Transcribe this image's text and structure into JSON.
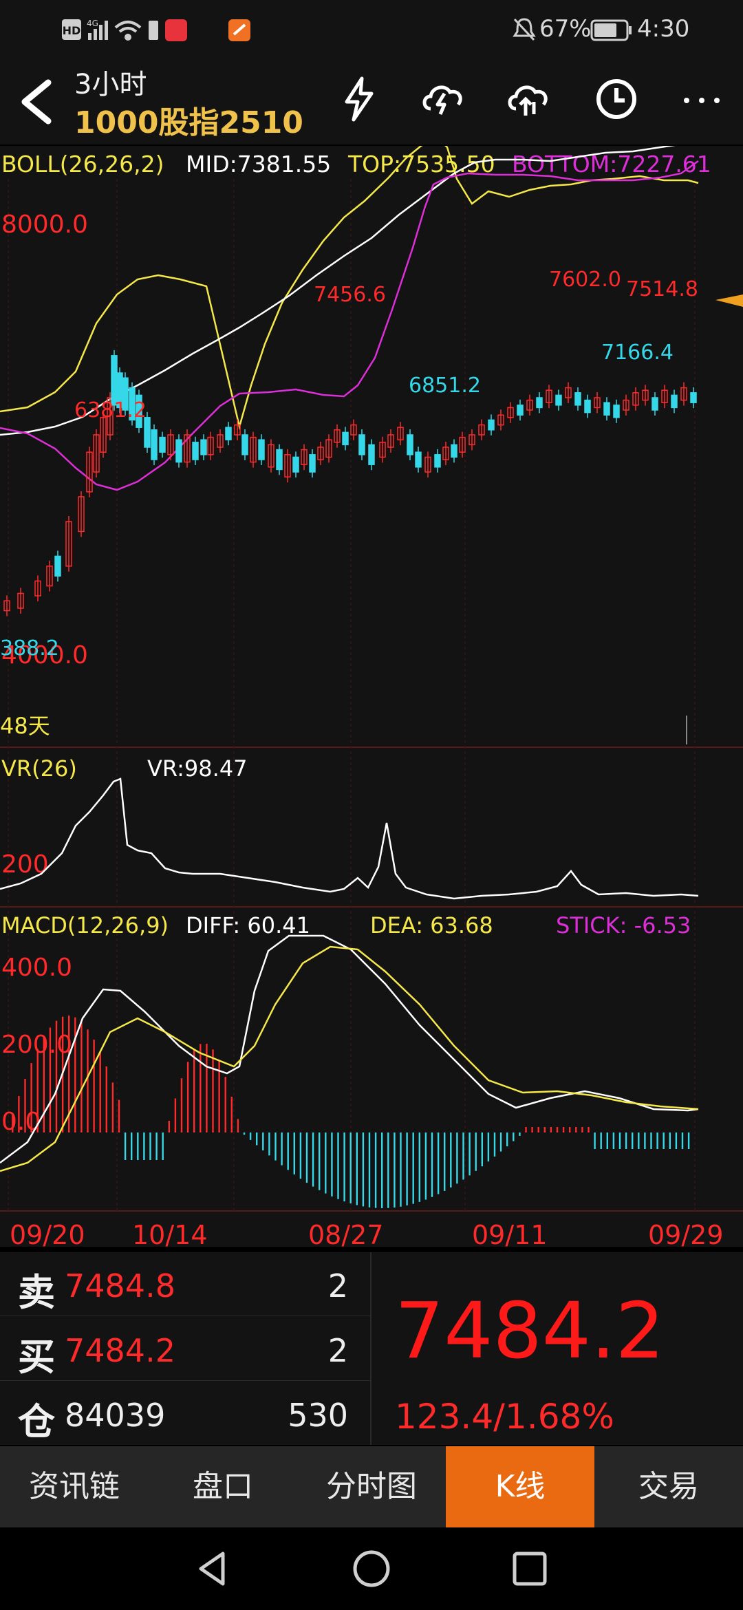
{
  "status_bar": {
    "left_icons": [
      "hd-icon",
      "4g-signal-icon",
      "wifi-icon",
      "battery-saver-icon",
      "app-notification-icon",
      "app-notification-icon-2"
    ],
    "mute_icon": "bell-off-icon",
    "battery_percent": "67%",
    "time": "4:30"
  },
  "header": {
    "period": "3小时",
    "instrument": "1000股指2510"
  },
  "boll": {
    "title": "BOLL(26,26,2)",
    "mid": "MID:7381.55",
    "top": "TOP:7535.50",
    "bottom": "BOTTOM:7227.61",
    "y_high": "8000.0",
    "y_low": "4000.0",
    "labels": {
      "peak1": "6381.2",
      "peak2": "7456.6",
      "trough2": "6851.2",
      "peak3": "7602.0",
      "peak4": "7514.8",
      "trough3": "7166.4",
      "left_low": "388.2"
    },
    "range_label": "48天"
  },
  "vr": {
    "title": "VR(26)",
    "value": "VR:98.47",
    "tick": "200"
  },
  "macd": {
    "title": "MACD(12,26,9)",
    "diff": "DIFF: 60.41",
    "dea": "DEA: 63.68",
    "stick": "STICK: -6.53",
    "ticks": [
      "400.0",
      "200.0",
      "0.0"
    ]
  },
  "x_axis": [
    "09/20",
    "10/14",
    "08/27",
    "09/11",
    "09/29"
  ],
  "quote": {
    "sell_label": "卖",
    "sell_price": "7484.8",
    "sell_qty": "2",
    "buy_label": "买",
    "buy_price": "7484.2",
    "buy_qty": "2",
    "oi_label": "仓",
    "oi_value": "84039",
    "oi_change": "530",
    "last_price": "7484.2",
    "change": "123.4/1.68%"
  },
  "tabs": [
    {
      "label": "资讯链",
      "active": false
    },
    {
      "label": "盘口",
      "active": false
    },
    {
      "label": "分时图",
      "active": false
    },
    {
      "label": "K线",
      "active": true
    },
    {
      "label": "交易",
      "active": false
    }
  ],
  "colors": {
    "up": "#ff2a2a",
    "down": "#35d8e8",
    "mid_line": "#ffffff",
    "top_line": "#f5e84a",
    "bottom_line": "#dd2fd8",
    "tab_active": "#ea6a12",
    "title_gold": "#f0c24b"
  }
}
